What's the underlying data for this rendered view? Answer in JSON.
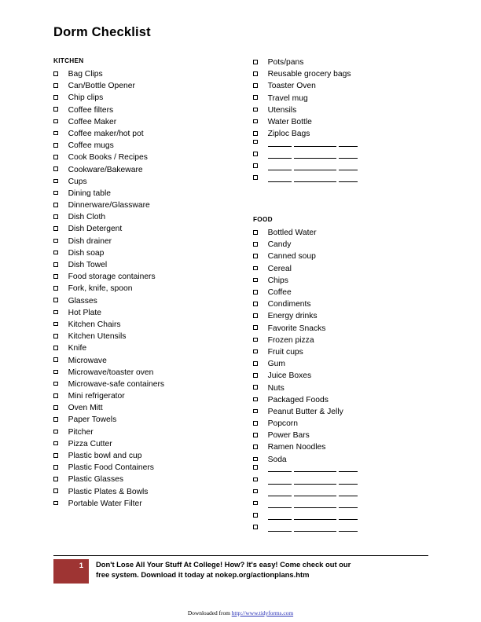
{
  "document": {
    "title": "Dorm Checklist"
  },
  "columns": {
    "left": [
      {
        "heading": "KITCHEN",
        "items": [
          "Bag Clips",
          "Can/Bottle Opener",
          "Chip clips",
          "Coffee filters",
          "Coffee Maker",
          "Coffee maker/hot pot",
          "Coffee mugs",
          "Cook Books / Recipes",
          "Cookware/Bakeware",
          "Cups",
          "Dining table",
          "Dinnerware/Glassware",
          "Dish Cloth",
          "Dish Detergent",
          "Dish drainer",
          "Dish soap",
          "Dish Towel",
          "Food storage containers",
          "Fork, knife, spoon",
          "Glasses",
          "Hot Plate",
          "Kitchen Chairs",
          "Kitchen Utensils",
          "Knife",
          "Microwave",
          "Microwave/toaster oven",
          "Microwave-safe containers",
          "Mini refrigerator",
          "Oven Mitt",
          "Paper Towels",
          "Pitcher",
          "Pizza Cutter",
          "Plastic bowl and cup",
          "Plastic Food Containers",
          "Plastic Glasses",
          "Plastic Plates & Bowls",
          "Portable Water Filter"
        ],
        "blank_lines": 0
      }
    ],
    "right": [
      {
        "heading": "",
        "items": [
          "Pots/pans",
          "Reusable grocery bags",
          "Toaster Oven",
          "Travel mug",
          "Utensils",
          "Water Bottle",
          "Ziploc Bags"
        ],
        "blank_lines": 4
      },
      {
        "heading": "FOOD",
        "items": [
          "Bottled Water",
          "Candy",
          "Canned soup",
          "Cereal",
          "Chips",
          "Coffee",
          "Condiments",
          "Energy drinks",
          "Favorite Snacks",
          "Frozen pizza",
          "Fruit cups",
          "Gum",
          "Juice Boxes",
          "Nuts",
          "Packaged Foods",
          "Peanut Butter & Jelly",
          "Popcorn",
          "Power Bars",
          "Ramen Noodles",
          "Soda"
        ],
        "blank_lines": 6
      }
    ]
  },
  "promo": {
    "number": "1",
    "line1": "Don't Lose All Your Stuff At College!   How?  It's easy!   Come check out our",
    "line2": "free system.  Download it today at nokep.org/actionplans.htm",
    "accent_color": "#9e3433"
  },
  "attribution": {
    "prefix": "Downloaded from ",
    "url": "http://www.tidyforms.com",
    "url_color": "#2b33b8"
  }
}
